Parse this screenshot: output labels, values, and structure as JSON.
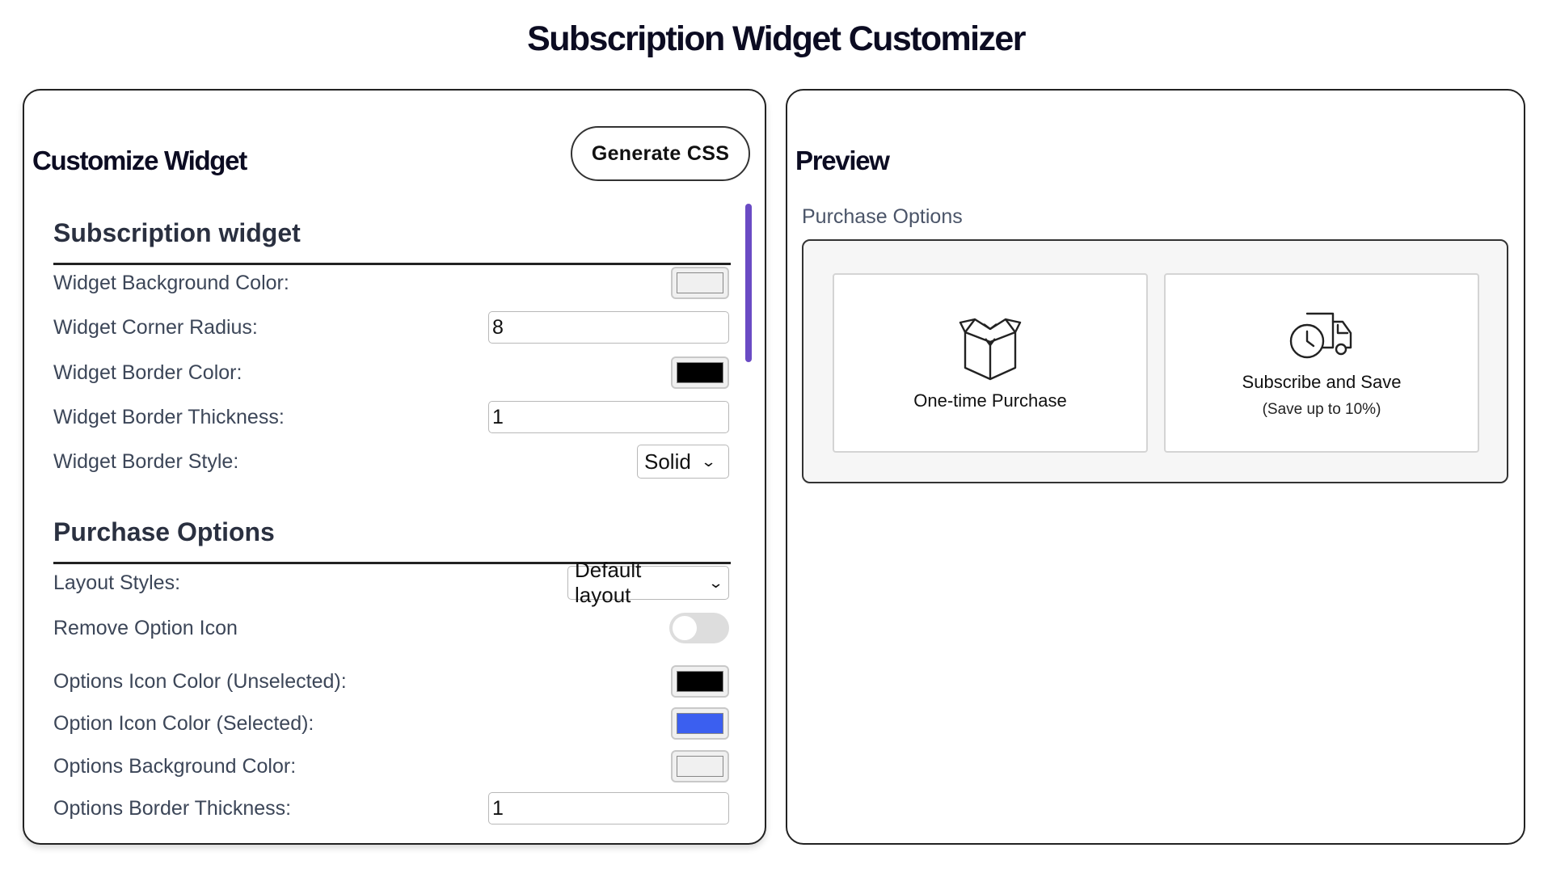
{
  "page_title": "Subscription Widget Customizer",
  "left_panel": {
    "title": "Customize Widget",
    "generate_button": "Generate CSS",
    "sections": {
      "subscription_widget": {
        "title": "Subscription widget",
        "rows": {
          "bg_color": {
            "label": "Widget Background Color:",
            "value": "#f0f0f0"
          },
          "corner_radius": {
            "label": "Widget Corner Radius:",
            "value": "8"
          },
          "border_color": {
            "label": "Widget Border Color:",
            "value": "#000000"
          },
          "border_thickness": {
            "label": "Widget Border Thickness:",
            "value": "1"
          },
          "border_style": {
            "label": "Widget Border Style:",
            "value": "Solid"
          }
        }
      },
      "purchase_options": {
        "title": "Purchase Options",
        "rows": {
          "layout_styles": {
            "label": "Layout Styles:",
            "value": "Default layout"
          },
          "remove_icon": {
            "label": "Remove Option Icon",
            "value": false
          },
          "icon_color_unselected": {
            "label": "Options Icon Color (Unselected):",
            "value": "#000000"
          },
          "icon_color_selected": {
            "label": "Option Icon Color (Selected):",
            "value": "#3b5ff0"
          },
          "options_bg_color": {
            "label": "Options Background Color:",
            "value": "#f0f0f0"
          },
          "options_border_thickness": {
            "label": "Options Border Thickness:",
            "value": "1"
          }
        }
      }
    }
  },
  "preview": {
    "title": "Preview",
    "group_label": "Purchase Options",
    "options": [
      {
        "title": "One-time Purchase",
        "icon": "box-icon"
      },
      {
        "title": "Subscribe and Save",
        "subtitle": "(Save up to 10%)",
        "icon": "delivery-truck-clock-icon"
      }
    ]
  },
  "colors": {
    "scrollbar": "#6a4bc4",
    "toggle_off": "#dddddd"
  }
}
